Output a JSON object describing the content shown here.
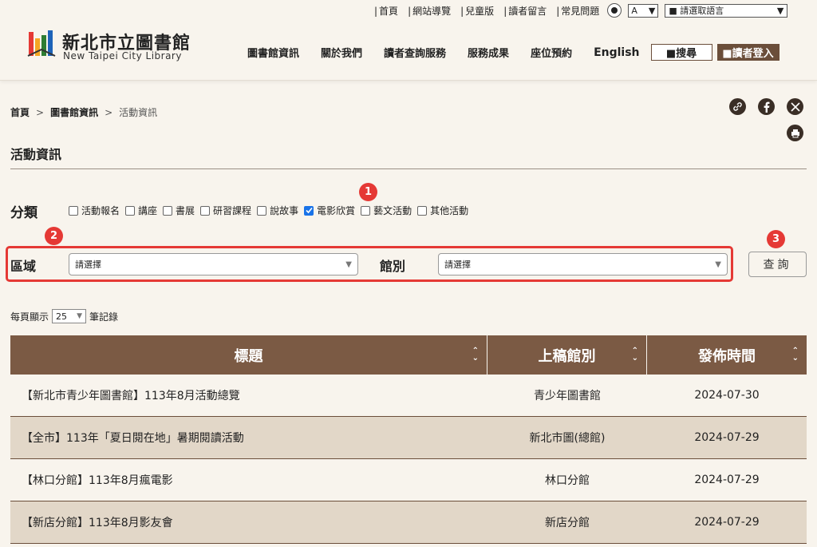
{
  "utility_links": [
    "首頁",
    "網站導覽",
    "兒童版",
    "讀者留言",
    "常見問題"
  ],
  "font_size": {
    "value": "A",
    "caret": "▼"
  },
  "language_select": {
    "value": "■ 請選取語言",
    "caret": "▼"
  },
  "logo": {
    "title": "新北市立圖書館",
    "subtitle": "New Taipei City Library"
  },
  "nav": [
    "圖書館資訊",
    "關於我們",
    "讀者查詢服務",
    "服務成果",
    "座位預約",
    "English"
  ],
  "search_button": "■搜尋",
  "login_button": "■讀者登入",
  "breadcrumb": {
    "home": "首頁",
    "sep": ">",
    "parent": "圖書館資訊",
    "current": "活動資訊"
  },
  "share_icons": [
    "link-icon",
    "facebook-icon",
    "x-icon",
    "print-icon"
  ],
  "page_title": "活動資訊",
  "category": {
    "label": "分類",
    "options": [
      {
        "label": "活動報名",
        "checked": false
      },
      {
        "label": "講座",
        "checked": false
      },
      {
        "label": "書展",
        "checked": false
      },
      {
        "label": "研習課程",
        "checked": false
      },
      {
        "label": "說故事",
        "checked": false
      },
      {
        "label": "電影欣賞",
        "checked": true
      },
      {
        "label": "藝文活動",
        "checked": false
      },
      {
        "label": "其他活動",
        "checked": false
      }
    ]
  },
  "markers": [
    "1",
    "2",
    "3"
  ],
  "region": {
    "label": "區域",
    "value": "請選擇"
  },
  "branch": {
    "label": "館別",
    "value": "請選擇"
  },
  "query_button": "查詢",
  "per_page": {
    "prefix": "每頁顯示",
    "value": "25",
    "suffix": "筆記錄"
  },
  "table": {
    "headers": [
      "標題",
      "上稿館別",
      "發佈時間"
    ],
    "rows": [
      {
        "title": "【新北市青少年圖書館】113年8月活動總覽",
        "library": "青少年圖書館",
        "date": "2024-07-30"
      },
      {
        "title": "【全市】113年「夏日閱在地」暑期閱讀活動",
        "library": "新北市圖(總館)",
        "date": "2024-07-29"
      },
      {
        "title": "【林口分館】113年8月瘋電影",
        "library": "林口分館",
        "date": "2024-07-29"
      },
      {
        "title": "【新店分館】113年8月影友會",
        "library": "新店分館",
        "date": "2024-07-29"
      }
    ]
  },
  "colors": {
    "brand": "#7b5a44",
    "accent": "#e53935",
    "row_alt": "#e2d7c8",
    "background": "#f8f4ed"
  }
}
